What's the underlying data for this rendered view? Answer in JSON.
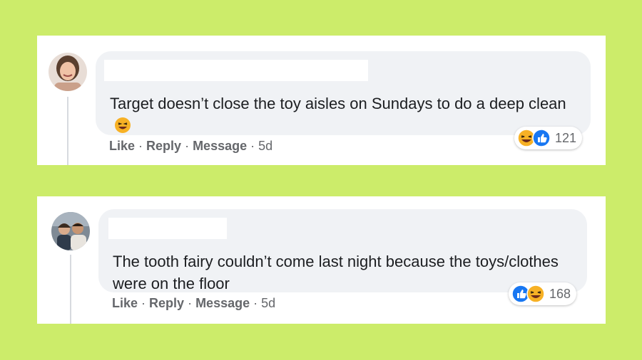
{
  "comments": [
    {
      "text": "Target doesn’t close the toy aisles on Sundays to do a deep clean",
      "actions": {
        "like": "Like",
        "reply": "Reply",
        "message": "Message",
        "time": "5d"
      },
      "reactions": {
        "icons": [
          "laugh-icon",
          "like-icon"
        ],
        "count": "121"
      }
    },
    {
      "text": "The tooth fairy couldn’t come last night because the toys/clothes were on the floor",
      "actions": {
        "like": "Like",
        "reply": "Reply",
        "message": "Message",
        "time": "5d"
      },
      "reactions": {
        "icons": [
          "like-icon",
          "laugh-icon"
        ],
        "count": "168"
      }
    }
  ],
  "separator": "·",
  "colors": {
    "background": "#ccec6a",
    "bubble": "#f0f2f5",
    "text": "#1c1e21",
    "meta": "#65676b",
    "like_blue": "#1877f2",
    "haha_yellow": "#f7b125"
  }
}
